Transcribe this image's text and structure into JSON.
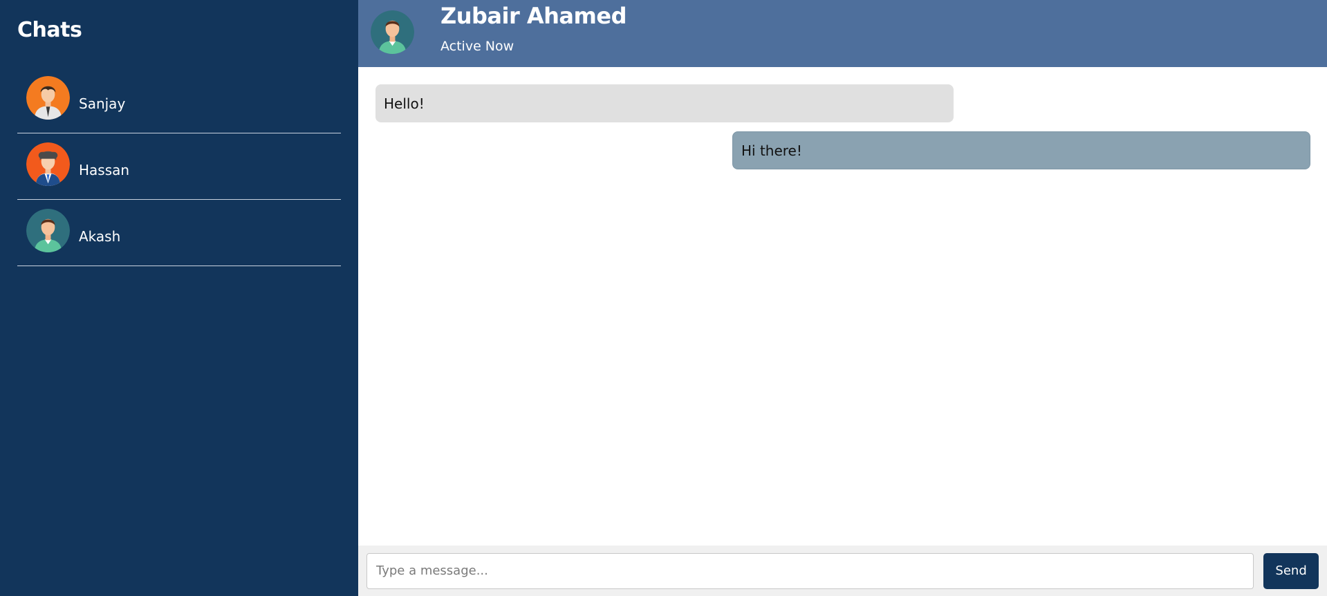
{
  "sidebar": {
    "title": "Chats",
    "items": [
      {
        "name": "Sanjay",
        "avatar": "avatar-sanjay"
      },
      {
        "name": "Hassan",
        "avatar": "avatar-hassan"
      },
      {
        "name": "Akash",
        "avatar": "avatar-akash"
      }
    ]
  },
  "header": {
    "name": "Zubair Ahamed",
    "status": "Active Now",
    "avatar": "avatar-zubair"
  },
  "messages": [
    {
      "direction": "received",
      "text": "Hello!"
    },
    {
      "direction": "sent",
      "text": "Hi there!"
    }
  ],
  "composer": {
    "placeholder": "Type a message...",
    "send_label": "Send"
  },
  "colors": {
    "sidebar_bg": "#12355b",
    "header_bg": "#4e6f9c",
    "received_bubble": "#e0e0e0",
    "sent_bubble": "#8aa2b1",
    "composer_bg": "#f0f0f0",
    "send_button": "#12355b"
  }
}
